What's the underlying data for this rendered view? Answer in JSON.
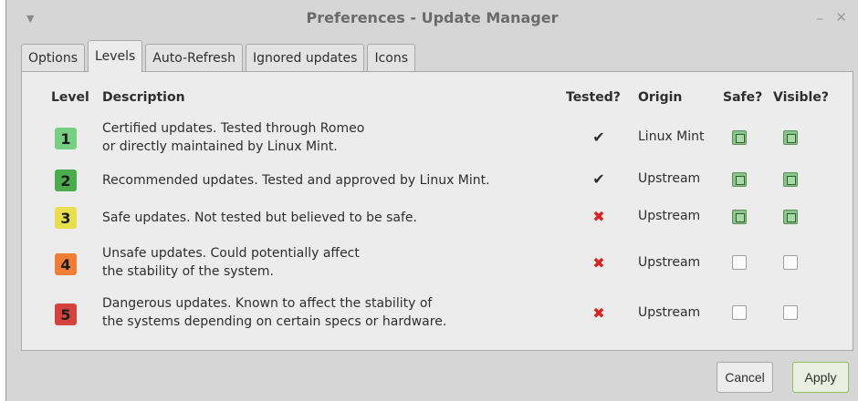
{
  "window": {
    "title": "Preferences - Update Manager",
    "menu_glyph": "▼",
    "minimize_glyph": "–",
    "close_glyph": "✕"
  },
  "tabs": [
    {
      "label": "Options",
      "active": false
    },
    {
      "label": "Levels",
      "active": true
    },
    {
      "label": "Auto-Refresh",
      "active": false
    },
    {
      "label": "Ignored updates",
      "active": false
    },
    {
      "label": "Icons",
      "active": false
    }
  ],
  "table": {
    "headers": {
      "level": "Level",
      "description": "Description",
      "tested": "Tested?",
      "origin": "Origin",
      "safe": "Safe?",
      "visible": "Visible?"
    },
    "rows": [
      {
        "level": "1",
        "description_line1": "Certified updates. Tested through Romeo",
        "description_line2": "or directly maintained by Linux Mint.",
        "tested": "✔",
        "tested_ok": true,
        "origin": "Linux Mint",
        "safe": true,
        "visible": true,
        "color": "#78cf83"
      },
      {
        "level": "2",
        "description_line1": "Recommended updates. Tested and approved by Linux Mint.",
        "description_line2": "",
        "tested": "✔",
        "tested_ok": true,
        "origin": "Upstream",
        "safe": true,
        "visible": true,
        "color": "#4cab4c"
      },
      {
        "level": "3",
        "description_line1": "Safe updates. Not tested but believed to be safe.",
        "description_line2": "",
        "tested": "✖",
        "tested_ok": false,
        "origin": "Upstream",
        "safe": true,
        "visible": true,
        "color": "#e8de4e"
      },
      {
        "level": "4",
        "description_line1": "Unsafe updates. Could potentially affect",
        "description_line2": "the stability of the system.",
        "tested": "✖",
        "tested_ok": false,
        "origin": "Upstream",
        "safe": false,
        "visible": false,
        "color": "#ee7d35"
      },
      {
        "level": "5",
        "description_line1": "Dangerous updates. Known to affect the stability of",
        "description_line2": "the systems depending on certain specs or hardware.",
        "tested": "✖",
        "tested_ok": false,
        "origin": "Upstream",
        "safe": false,
        "visible": false,
        "color": "#d6433f"
      }
    ]
  },
  "buttons": {
    "cancel": "Cancel",
    "apply": "Apply"
  }
}
